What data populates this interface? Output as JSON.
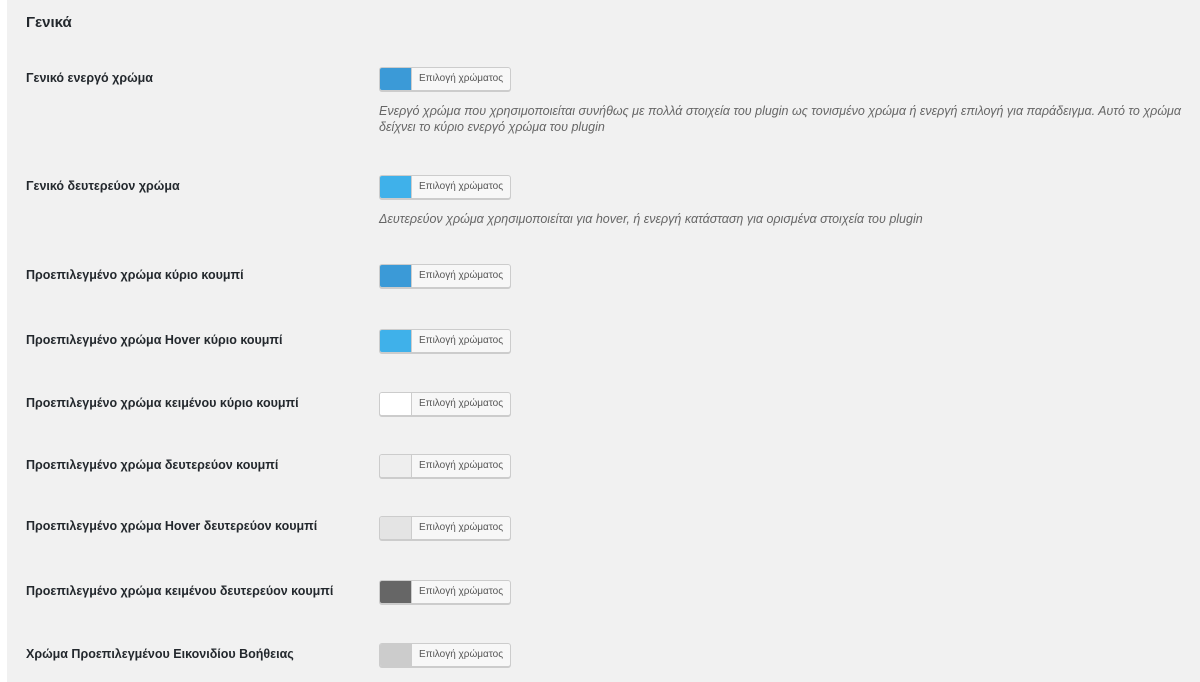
{
  "section": {
    "title": "Γενικά"
  },
  "picker_label": "Επιλογή χρώματος",
  "rows": [
    {
      "label": "Γενικό ενεργό χρώμα",
      "color": "#3b9ad7",
      "description": "Ενεργό χρώμα που χρησιμοποιείται συνήθως με πολλά στοιχεία του plugin ως τονισμένο χρώμα ή ενεργή επιλογή για παράδειγμα. Αυτό το χρώμα δείχνει το κύριο ενεργό χρώμα του plugin"
    },
    {
      "label": "Γενικό δευτερεύον χρώμα",
      "color": "#3fb1ea",
      "description": "Δευτερεύον χρώμα χρησιμοποιείται για hover, ή ενεργή κατάσταση για ορισμένα στοιχεία του plugin"
    },
    {
      "label": "Προεπιλεγμένο χρώμα κύριο κουμπί",
      "color": "#3b9ad7"
    },
    {
      "label": "Προεπιλεγμένο χρώμα Hover κύριο κουμπί",
      "color": "#3fb1ea"
    },
    {
      "label": "Προεπιλεγμένο χρώμα κειμένου κύριο κουμπί",
      "color": "#ffffff"
    },
    {
      "label": "Προεπιλεγμένο χρώμα δευτερεύον κουμπί",
      "color": "#eeeeee"
    },
    {
      "label": "Προεπιλεγμένο χρώμα Hover δευτερεύον κουμπί",
      "color": "#e4e4e4"
    },
    {
      "label": "Προεπιλεγμένο χρώμα κειμένου δευτερεύον κουμπί",
      "color": "#666666"
    },
    {
      "label": "Χρώμα Προεπιλεγμένου Εικονιδίου Βοήθειας",
      "color": "#cccccc"
    }
  ]
}
